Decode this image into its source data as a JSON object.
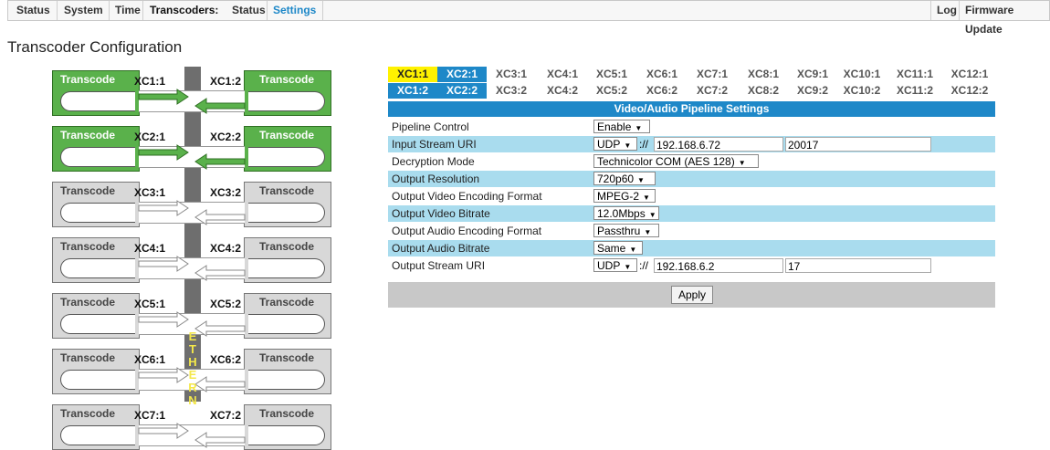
{
  "nav": {
    "items": [
      "Status",
      "System",
      "Time",
      "Transcoders:",
      "Status",
      "Settings"
    ],
    "right": [
      "Log",
      "Firmware Update"
    ]
  },
  "page": {
    "title": "Transcoder Configuration"
  },
  "diagram": {
    "left_box_label": "Transcode",
    "right_box_label": "Transcode",
    "ether_letters": [
      "E",
      "T",
      "H",
      "E",
      "R",
      "N"
    ],
    "rows": [
      {
        "left": "XC1:1",
        "right": "XC1:2",
        "active": true
      },
      {
        "left": "XC2:1",
        "right": "XC2:2",
        "active": true
      },
      {
        "left": "XC3:1",
        "right": "XC3:2",
        "active": false
      },
      {
        "left": "XC4:1",
        "right": "XC4:2",
        "active": false
      },
      {
        "left": "XC5:1",
        "right": "XC5:2",
        "active": false
      },
      {
        "left": "XC6:1",
        "right": "XC6:2",
        "active": false
      },
      {
        "left": "XC7:1",
        "right": "XC7:2",
        "active": false
      }
    ]
  },
  "tabs": {
    "row1": [
      "XC1:1",
      "XC2:1",
      "XC3:1",
      "XC4:1",
      "XC5:1",
      "XC6:1",
      "XC7:1",
      "XC8:1",
      "XC9:1",
      "XC10:1",
      "XC11:1",
      "XC12:1"
    ],
    "row2": [
      "XC1:2",
      "XC2:2",
      "XC3:2",
      "XC4:2",
      "XC5:2",
      "XC6:2",
      "XC7:2",
      "XC8:2",
      "XC9:2",
      "XC10:2",
      "XC11:2",
      "XC12:2"
    ]
  },
  "settings": {
    "header": "Video/Audio Pipeline Settings",
    "pipeline_control": {
      "label": "Pipeline Control",
      "value": "Enable"
    },
    "input_stream_uri": {
      "label": "Input Stream URI",
      "protocol": "UDP",
      "sep": "://",
      "address": "192.168.6.72",
      "port": "20017"
    },
    "decryption_mode": {
      "label": "Decryption Mode",
      "value": "Technicolor COM (AES 128)"
    },
    "output_resolution": {
      "label": "Output Resolution",
      "value": "720p60"
    },
    "output_video_format": {
      "label": "Output Video Encoding Format",
      "value": "MPEG-2"
    },
    "output_video_bitrate": {
      "label": "Output Video Bitrate",
      "value": "12.0Mbps"
    },
    "output_audio_format": {
      "label": "Output Audio Encoding Format",
      "value": "Passthru"
    },
    "output_audio_bitrate": {
      "label": "Output Audio Bitrate",
      "value": "Same"
    },
    "output_stream_uri": {
      "label": "Output Stream URI",
      "protocol": "UDP",
      "sep": "://",
      "address": "192.168.6.2",
      "port": "17"
    },
    "apply_label": "Apply"
  },
  "colors": {
    "accent": "#1e88c8",
    "active_green": "#5ab14b",
    "inactive_gray": "#d8d8d8",
    "highlight_yellow": "#fff200",
    "row_blue": "#a9dcee"
  }
}
